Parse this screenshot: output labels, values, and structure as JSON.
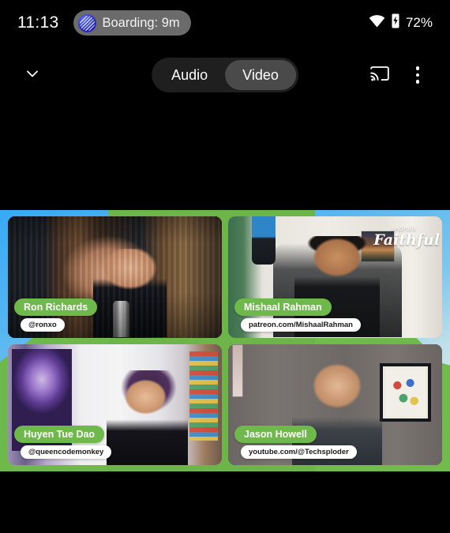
{
  "status_bar": {
    "clock": "11:13",
    "chip_label": "Boarding: 9m",
    "chip_icon": "flight-boarding-icon",
    "wifi_icon": "wifi-icon",
    "battery_icon": "battery-charging-icon",
    "battery_percent": "72%"
  },
  "toolbar": {
    "collapse_icon": "chevron-down-icon",
    "segments": [
      {
        "label": "Audio",
        "active": false
      },
      {
        "label": "Video",
        "active": true
      }
    ],
    "cast_icon": "cast-icon",
    "overflow_icon": "more-vertical-icon"
  },
  "stage": {
    "overlay_logo": {
      "top": "android",
      "main": "Faithful"
    },
    "colors": {
      "green": "#6fb84b",
      "blue": "#38a9f5",
      "badge_text": "#ffffff"
    },
    "participants": [
      {
        "name": "Ron Richards",
        "handle": "@ronxo"
      },
      {
        "name": "Mishaal Rahman",
        "handle": "patreon.com/MishaalRahman"
      },
      {
        "name": "Huyen Tue Dao",
        "handle": "@queencodemonkey"
      },
      {
        "name": "Jason Howell",
        "handle": "youtube.com/@Techsploder"
      }
    ]
  }
}
